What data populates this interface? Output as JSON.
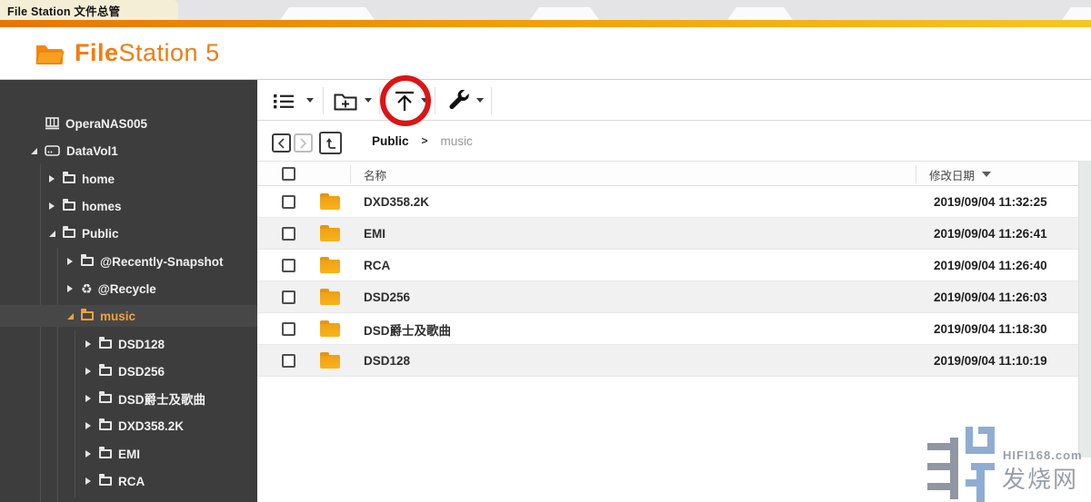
{
  "taskbar": {
    "active_tab": "File Station 文件总管"
  },
  "header": {
    "logo_bold": "File",
    "logo_rest": "Station 5"
  },
  "colors": {
    "accent_orange": "#f07d12",
    "folder_orange": "#f3a51c",
    "sidebar_bg": "#3d3d3d",
    "selected_text": "#f2a23a",
    "annotation_red": "#dc1414",
    "bar_gradient_start": "#e87500",
    "bar_gradient_end": "#f6c623"
  },
  "sidebar": {
    "tree": [
      {
        "label": "OperaNAS005",
        "level": 0,
        "icon": "nas",
        "state": "none",
        "selected": false
      },
      {
        "label": "DataVol1",
        "level": 1,
        "icon": "drive",
        "state": "expanded",
        "selected": false
      },
      {
        "label": "home",
        "level": 2,
        "icon": "folder",
        "state": "collapsed",
        "selected": false
      },
      {
        "label": "homes",
        "level": 2,
        "icon": "folder",
        "state": "collapsed",
        "selected": false
      },
      {
        "label": "Public",
        "level": 2,
        "icon": "folder",
        "state": "expanded",
        "selected": false
      },
      {
        "label": "@Recently-Snapshot",
        "level": 3,
        "icon": "folder",
        "state": "collapsed",
        "selected": false
      },
      {
        "label": "@Recycle",
        "level": 3,
        "icon": "recycle",
        "state": "collapsed",
        "selected": false
      },
      {
        "label": "music",
        "level": 3,
        "icon": "folder",
        "state": "expanded",
        "selected": true
      },
      {
        "label": "DSD128",
        "level": 4,
        "icon": "folder",
        "state": "collapsed",
        "selected": false
      },
      {
        "label": "DSD256",
        "level": 4,
        "icon": "folder",
        "state": "collapsed",
        "selected": false
      },
      {
        "label": "DSD爵士及歌曲",
        "level": 4,
        "icon": "folder",
        "state": "collapsed",
        "selected": false
      },
      {
        "label": "DXD358.2K",
        "level": 4,
        "icon": "folder",
        "state": "collapsed",
        "selected": false
      },
      {
        "label": "EMI",
        "level": 4,
        "icon": "folder",
        "state": "collapsed",
        "selected": false
      },
      {
        "label": "RCA",
        "level": 4,
        "icon": "folder",
        "state": "collapsed",
        "selected": false
      }
    ]
  },
  "toolbar": {
    "buttons": [
      "view-mode",
      "create-folder",
      "upload",
      "tools"
    ],
    "annotation": "red-circle-highlight-on-upload"
  },
  "breadcrumb": {
    "current": "Public",
    "separator": ">",
    "sub": "music"
  },
  "table": {
    "columns": {
      "name": "名称",
      "modified": "修改日期"
    },
    "sort": {
      "column": "modified",
      "direction": "desc"
    },
    "rows": [
      {
        "name": "DXD358.2K",
        "date": "2019/09/04 11:32:25"
      },
      {
        "name": "EMI",
        "date": "2019/09/04 11:26:41"
      },
      {
        "name": "RCA",
        "date": "2019/09/04 11:26:40"
      },
      {
        "name": "DSD256",
        "date": "2019/09/04 11:26:03"
      },
      {
        "name": "DSD爵士及歌曲",
        "date": "2019/09/04 11:18:30"
      },
      {
        "name": "DSD128",
        "date": "2019/09/04 11:10:19"
      }
    ]
  },
  "watermark": {
    "line1": "HIFI168.com",
    "line2": "发烧网"
  }
}
